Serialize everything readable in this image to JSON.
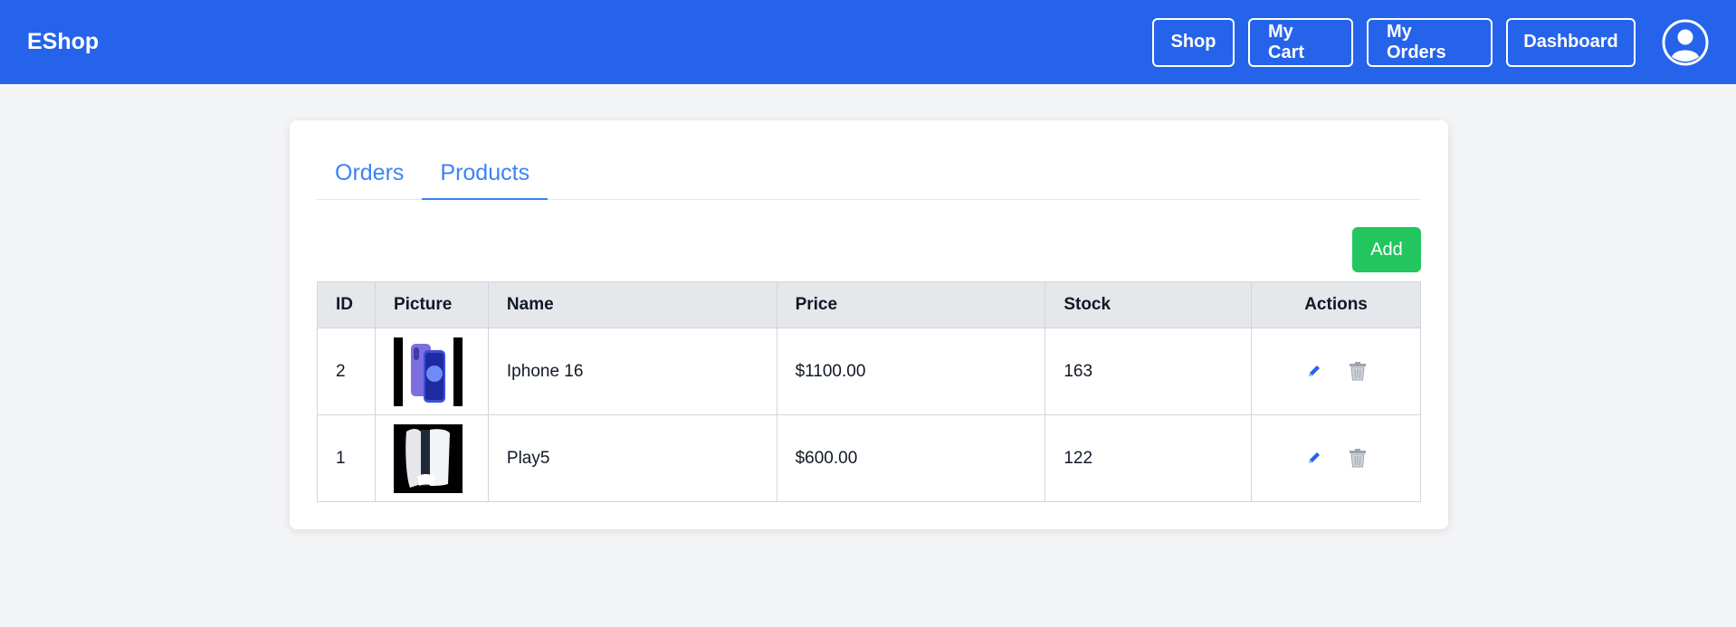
{
  "navbar": {
    "brand": "EShop",
    "buttons": {
      "shop": "Shop",
      "cart": "My Cart",
      "orders": "My Orders",
      "dashboard": "Dashboard"
    },
    "avatar_icon": "user-circle-icon"
  },
  "tabs": {
    "orders": "Orders",
    "products": "Products",
    "active": "products"
  },
  "actions": {
    "add_label": "Add"
  },
  "table": {
    "headers": {
      "id": "ID",
      "picture": "Picture",
      "name": "Name",
      "price": "Price",
      "stock": "Stock",
      "actions": "Actions"
    },
    "rows": [
      {
        "id": "2",
        "name": "Iphone 16",
        "price": "$1100.00",
        "stock": "163",
        "picture_icon": "phone-image"
      },
      {
        "id": "1",
        "name": "Play5",
        "price": "$600.00",
        "stock": "122",
        "picture_icon": "console-image"
      }
    ]
  },
  "colors": {
    "navbar": "#2563eb",
    "accent": "#3b82f6",
    "add_button": "#22c55e",
    "page_bg": "#f3f4f6"
  }
}
